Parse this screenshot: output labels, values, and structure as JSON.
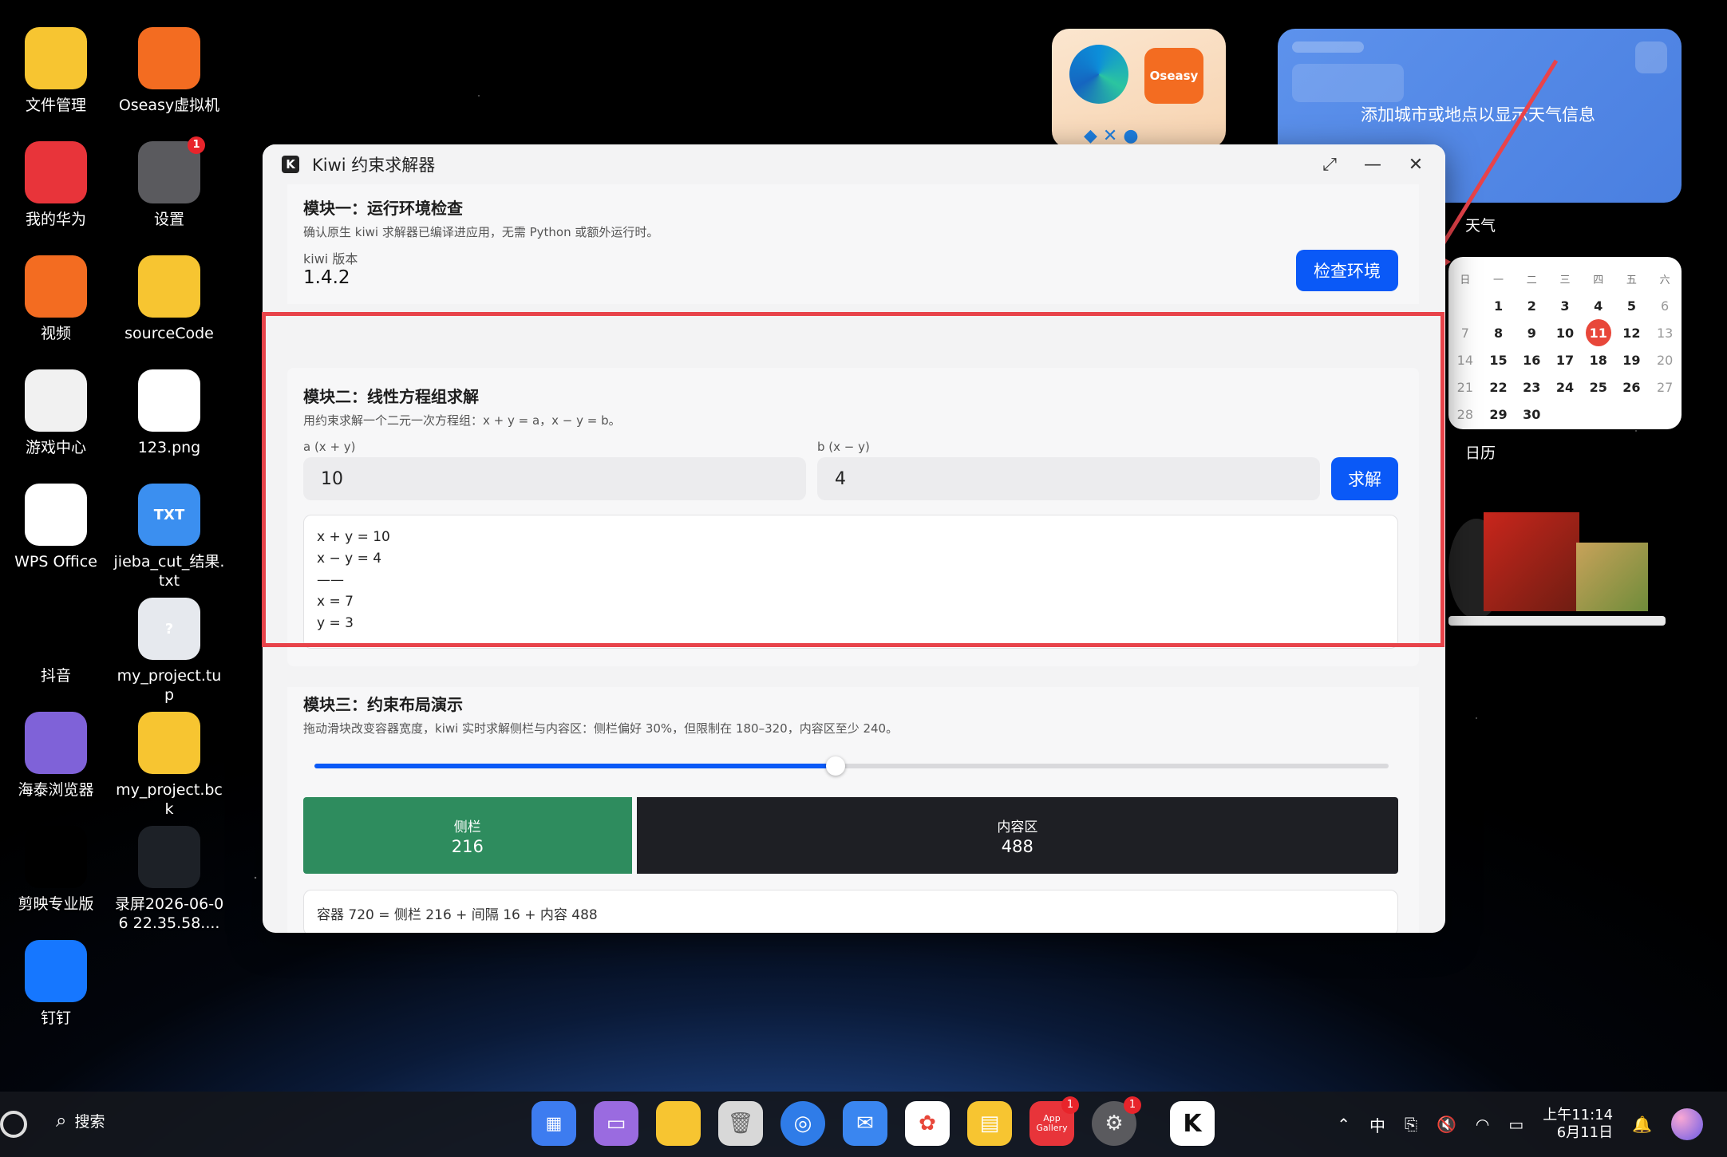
{
  "desktop": {
    "icons_col1": [
      {
        "label": "文件管理",
        "icon": "folder-icon",
        "color": "#f7c531"
      },
      {
        "label": "我的华为",
        "icon": "huawei-icon",
        "color": "#e8343a"
      },
      {
        "label": "视频",
        "icon": "video-icon",
        "color": "#f36c21"
      },
      {
        "label": "游戏中心",
        "icon": "gamepad-icon",
        "color": "#f1f1f1"
      },
      {
        "label": "WPS Office",
        "icon": "wps-icon",
        "color": "#ffffff"
      },
      {
        "label": "抖音",
        "icon": "tiktok-icon",
        "color": "#000000"
      },
      {
        "label": "海泰浏览器",
        "icon": "browser-icon",
        "color": "#7f62d8"
      },
      {
        "label": "剪映专业版",
        "icon": "capcut-icon",
        "color": "#000000"
      },
      {
        "label": "钉钉",
        "icon": "dingtalk-icon",
        "color": "#1677ff"
      }
    ],
    "icons_col2": [
      {
        "label": "Oseasy虚拟机",
        "icon": "vm-icon",
        "color": "#f36c21"
      },
      {
        "label": "设置",
        "icon": "settings-icon",
        "color": "#5a5a5e",
        "badge": "1"
      },
      {
        "label": "sourceCode",
        "icon": "folder-icon",
        "color": "#f7c531"
      },
      {
        "label": "123.png",
        "icon": "image-file-icon",
        "color": "#ffffff"
      },
      {
        "label": "jieba_cut_结果.txt",
        "icon": "txt-file-icon",
        "color": "#3b8ff0",
        "text": "TXT"
      },
      {
        "label": "my_project.tup",
        "icon": "unknown-file-icon",
        "color": "#e6e9ee",
        "text": "?"
      },
      {
        "label": "my_project.bck",
        "icon": "folder-icon",
        "color": "#f7c531"
      },
      {
        "label": "录屏2026-06-06 22.35.58....",
        "icon": "video-file-icon",
        "color": "#1d2127"
      }
    ]
  },
  "window": {
    "title": "Kiwi 约束求解器",
    "logo": "K",
    "controls": {
      "maximize": "⤢",
      "minimize": "—",
      "close": "✕"
    }
  },
  "module1": {
    "title": "模块一：运行环境检查",
    "desc": "确认原生 kiwi 求解器已编译进应用，无需 Python 或额外运行时。",
    "version_label": "kiwi 版本",
    "version_value": "1.4.2",
    "check_button": "检查环境"
  },
  "module2": {
    "title": "模块二：线性方程组求解",
    "desc": "用约束求解一个二元一次方程组：x + y = a，x − y = b。",
    "a_label": "a (x + y)",
    "a_value": "10",
    "b_label": "b (x − y)",
    "b_value": "4",
    "solve_button": "求解",
    "result_lines": [
      "x + y = 10",
      "x − y = 4",
      "——",
      "x = 7",
      "y = 3"
    ]
  },
  "module3": {
    "title": "模块三：约束布局演示",
    "desc": "拖动滑块改变容器宽度，kiwi 实时求解侧栏与内容区：侧栏偏好 30%，但限制在 180–320，内容区至少 240。",
    "slider_fraction": 0.485,
    "sidebar_label": "侧栏",
    "sidebar_value": "216",
    "content_label": "内容区",
    "content_value": "488",
    "container": 720,
    "gap": 16,
    "info": "容器 720 = 侧栏 216 + 间隔 16 + 内容 488"
  },
  "widgets": {
    "weather_text": "添加城市或地点以显示天气信息",
    "weather_label": "天气",
    "calendar_label": "日历",
    "calendar_headers": [
      "日",
      "一",
      "二",
      "三",
      "四",
      "五",
      "六"
    ],
    "calendar_days": [
      "",
      "1",
      "2",
      "3",
      "4",
      "5",
      "6",
      "7",
      "8",
      "9",
      "10",
      "11",
      "12",
      "13",
      "14",
      "15",
      "16",
      "17",
      "18",
      "19",
      "20",
      "21",
      "22",
      "23",
      "24",
      "25",
      "26",
      "27",
      "28",
      "29",
      "30"
    ],
    "today": "11",
    "app_badge": "Oseasy"
  },
  "taskbar": {
    "search_label": "搜索",
    "time": "上午11:14",
    "date": "6月11日",
    "ime": "中",
    "dock_badges": {
      "app_gallery": "1",
      "settings": "1"
    },
    "app_gallery_label": "App Gallery"
  },
  "colors": {
    "accent": "#0a59f7",
    "highlight": "#e8434a",
    "sidebar": "#2e8c5e",
    "content": "#1e1f24",
    "today": "#e8473a"
  }
}
